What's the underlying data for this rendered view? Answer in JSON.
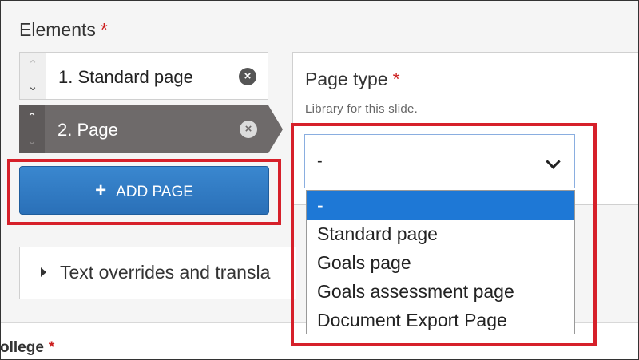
{
  "elements": {
    "label": "Elements",
    "required_mark": "*"
  },
  "items": [
    {
      "label": "1. Standard page",
      "remove_icon": "close-circle-icon"
    },
    {
      "label": "2. Page",
      "remove_icon": "close-circle-icon"
    }
  ],
  "add_button": {
    "label": "ADD PAGE",
    "icon": "plus-icon"
  },
  "page_type": {
    "label": "Page type",
    "required_mark": "*",
    "description": "Library for this slide.",
    "selected": "-",
    "options": [
      "-",
      "Standard page",
      "Goals page",
      "Goals assessment page",
      "Document Export Page"
    ]
  },
  "text_overrides": {
    "label": "Text overrides and transla"
  },
  "college": {
    "label": "ollege",
    "required_mark": "*"
  },
  "colors": {
    "accent": "#2a70b8",
    "highlight": "#d6202a",
    "option_selected": "#1e78d6"
  }
}
